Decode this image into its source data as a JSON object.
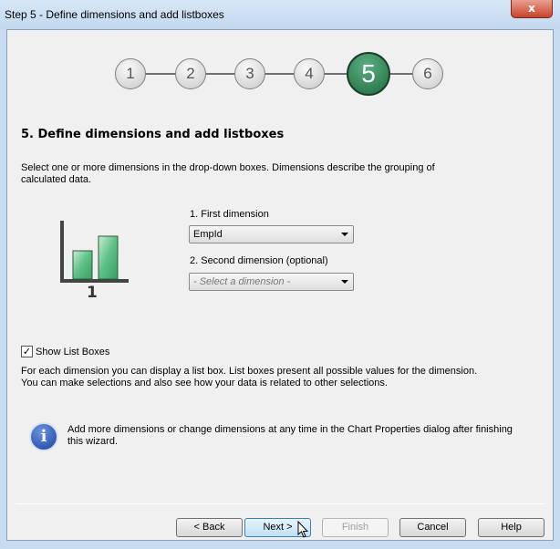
{
  "window": {
    "title": "Step 5 - Define dimensions and add listboxes",
    "close_label": "x"
  },
  "steps": [
    {
      "label": "1"
    },
    {
      "label": "2"
    },
    {
      "label": "3"
    },
    {
      "label": "4"
    },
    {
      "label": "5",
      "active": true
    },
    {
      "label": "6"
    }
  ],
  "heading": "5. Define dimensions and add listboxes",
  "intro": "Select one or more dimensions in the drop-down boxes. Dimensions describe the grouping of calculated data.",
  "illustration_label": "1",
  "first_dimension": {
    "label": "1. First dimension",
    "value": "EmpId"
  },
  "second_dimension": {
    "label": "2. Second dimension (optional)",
    "placeholder": "- Select a dimension -"
  },
  "show_list_boxes": {
    "label": "Show List Boxes",
    "checked": true
  },
  "listbox_text": "For each dimension you can display a list box. List boxes present all possible values for the dimension. You can make selections and also see how your data is related to other selections.",
  "info_text": "Add more dimensions or change dimensions at any time in the Chart Properties dialog after finishing this wizard.",
  "buttons": {
    "back": "< Back",
    "next": "Next >",
    "finish": "Finish",
    "cancel": "Cancel",
    "help": "Help"
  }
}
